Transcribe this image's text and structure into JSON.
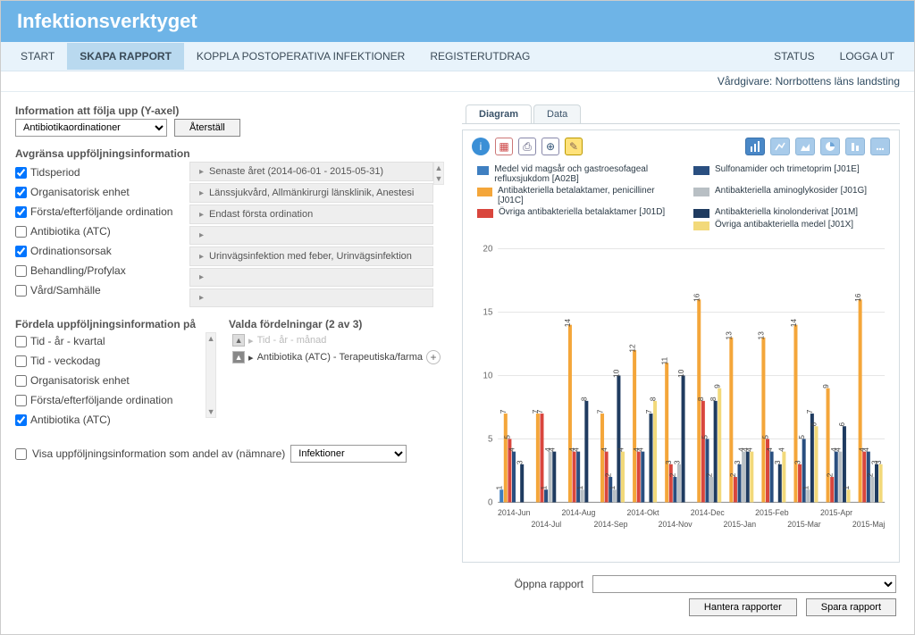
{
  "title": "Infektionsverktyget",
  "menu": {
    "start": "START",
    "skapa": "SKAPA RAPPORT",
    "koppla": "KOPPLA POSTOPERATIVA INFEKTIONER",
    "registerutdrag": "REGISTERUTDRAG",
    "status": "STATUS",
    "logout": "LOGGA UT"
  },
  "provider_label": "Vårdgivare: Norrbottens läns landsting",
  "yaxis": {
    "label": "Information att följa upp (Y-axel)",
    "value": "Antibiotikaordinationer",
    "reset": "Återställ"
  },
  "filters": {
    "title": "Avgränsa uppföljningsinformation",
    "items": [
      {
        "label": "Tidsperiod",
        "checked": true
      },
      {
        "label": "Organisatorisk enhet",
        "checked": true
      },
      {
        "label": "Första/efterföljande ordination",
        "checked": true
      },
      {
        "label": "Antibiotika (ATC)",
        "checked": false
      },
      {
        "label": "Ordinationsorsak",
        "checked": true
      },
      {
        "label": "Behandling/Profylax",
        "checked": false
      },
      {
        "label": "Vård/Samhälle",
        "checked": false
      }
    ],
    "accordion": [
      {
        "text": "Senaste året (2014-06-01 - 2015-05-31)",
        "dim": false
      },
      {
        "text": "Länssjukvård, Allmänkirurgi länsklinik, Anestesi",
        "dim": false
      },
      {
        "text": "Endast första ordination",
        "dim": false
      },
      {
        "text": "",
        "dim": true
      },
      {
        "text": "Urinvägsinfektion med feber, Urinvägsinfektion",
        "dim": false
      },
      {
        "text": "",
        "dim": true
      },
      {
        "text": "",
        "dim": true
      }
    ]
  },
  "fordela": {
    "title": "Fördela uppföljningsinformation på",
    "checks": [
      {
        "label": "Tid - år - kvartal",
        "checked": false
      },
      {
        "label": "Tid - veckodag",
        "checked": false
      },
      {
        "label": "Organisatorisk enhet",
        "checked": false
      },
      {
        "label": "Första/efterföljande ordination",
        "checked": false
      },
      {
        "label": "Antibiotika (ATC)",
        "checked": true
      }
    ],
    "valda_title": "Valda fördelningar (2 av 3)",
    "valda": [
      {
        "text": "Tid - år - månad",
        "disabled": true
      },
      {
        "text": "Antibiotika (ATC) - Terapeutiska/farma",
        "disabled": false
      }
    ]
  },
  "andel": {
    "label": "Visa uppföljningsinformation som andel av (nämnare)",
    "value": "Infektioner"
  },
  "tabs": {
    "diagram": "Diagram",
    "data": "Data"
  },
  "open_report_label": "Öppna rapport",
  "btn_manage": "Hantera rapporter",
  "btn_save": "Spara rapport",
  "chart_data": {
    "type": "bar",
    "ylabel": "",
    "ylim": [
      0,
      20
    ],
    "yticks": [
      0,
      5,
      10,
      15,
      20
    ],
    "categories": [
      "2014-Jun",
      "2014-Jul",
      "2014-Aug",
      "2014-Sep",
      "2014-Okt",
      "2014-Nov",
      "2014-Dec",
      "2015-Jan",
      "2015-Feb",
      "2015-Mar",
      "2015-Apr",
      "2015-Maj"
    ],
    "legend": [
      {
        "name": "Medel vid magsår och gastroesofageal refluxsjukdom [A02B]",
        "color": "#3f7fc1"
      },
      {
        "name": "Sulfonamider och trimetoprim [J01E]",
        "color": "#2a4f80"
      },
      {
        "name": "Antibakteriella betalaktamer, penicilliner [J01C]",
        "color": "#f4a63a"
      },
      {
        "name": "Antibakteriella aminoglykosider [J01G]",
        "color": "#b8bfc4"
      },
      {
        "name": "Övriga antibakteriella betalaktamer [J01D]",
        "color": "#d9463d"
      },
      {
        "name": "Antibakteriella kinolonderivat [J01M]",
        "color": "#1f3b60"
      },
      {
        "name": "",
        "color": "transparent"
      },
      {
        "name": "Övriga antibakteriella medel [J01X]",
        "color": "#f2d97a"
      }
    ],
    "series": [
      {
        "name": "A02B",
        "color": "#3f7fc1",
        "values": [
          1,
          null,
          null,
          null,
          null,
          null,
          null,
          null,
          null,
          null,
          null,
          null
        ]
      },
      {
        "name": "J01C",
        "color": "#f4a63a",
        "values": [
          7,
          7,
          14,
          7,
          12,
          11,
          16,
          13,
          13,
          14,
          9,
          16
        ]
      },
      {
        "name": "J01D",
        "color": "#d9463d",
        "values": [
          5,
          7,
          4,
          4,
          4,
          3,
          8,
          2,
          5,
          3,
          2,
          4
        ]
      },
      {
        "name": "J01E",
        "color": "#2a4f80",
        "values": [
          4,
          1,
          4,
          2,
          4,
          2,
          5,
          3,
          4,
          5,
          4,
          4
        ]
      },
      {
        "name": "J01G",
        "color": "#b8bfc4",
        "values": [
          null,
          4,
          1,
          1,
          null,
          3,
          2,
          4,
          null,
          1,
          4,
          2
        ]
      },
      {
        "name": "J01M",
        "color": "#1f3b60",
        "values": [
          3,
          4,
          8,
          10,
          7,
          10,
          8,
          4,
          3,
          7,
          6,
          3
        ]
      },
      {
        "name": "J01X",
        "color": "#f2d97a",
        "values": [
          null,
          null,
          null,
          4,
          8,
          null,
          9,
          4,
          4,
          6,
          1,
          3
        ]
      }
    ]
  }
}
